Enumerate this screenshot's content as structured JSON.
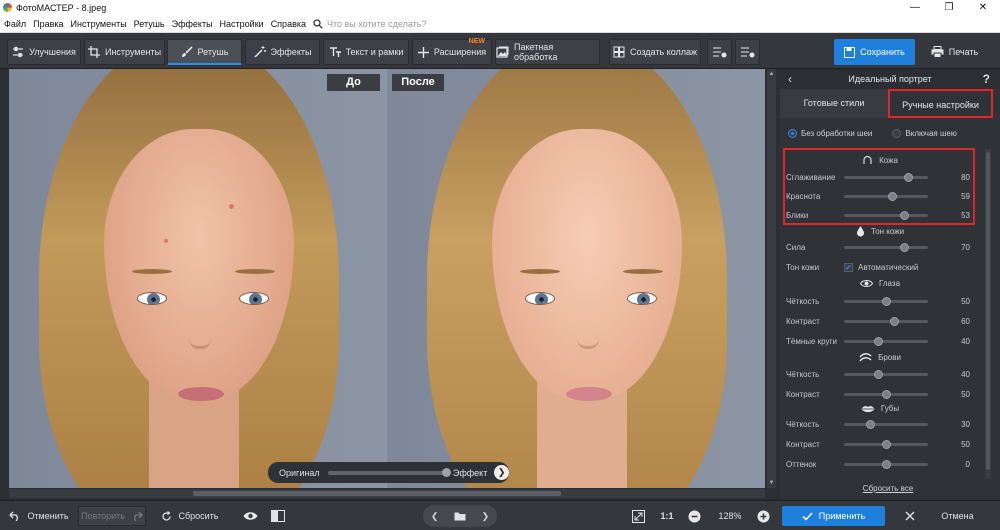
{
  "window": {
    "title": "ФотоМАСТЕР - 8.jpeg",
    "minimize": "—",
    "maximize": "❐",
    "close": "✕"
  },
  "menu": {
    "items": [
      "Файл",
      "Правка",
      "Инструменты",
      "Ретушь",
      "Эффекты",
      "Настройки",
      "Справка"
    ],
    "search_placeholder": "Что вы хотите сделать?"
  },
  "toolbar": {
    "enhance": "Улучшения",
    "tools": "Инструменты",
    "retouch": "Ретушь",
    "effects": "Эффекты",
    "text": "Текст и рамки",
    "extensions": "Расширения",
    "new_badge": "NEW",
    "batch": "Пакетная обработка",
    "collage": "Создать коллаж",
    "save": "Сохранить",
    "print": "Печать"
  },
  "canvas": {
    "before_label": "До",
    "after_label": "После",
    "slider": {
      "left_label": "Оригинал",
      "right_label": "Эффект",
      "value": 1.0
    }
  },
  "panel": {
    "title": "Идеальный портрет",
    "help": "?",
    "tabs": {
      "ready": "Готовые стили",
      "manual": "Ручные настройки"
    },
    "neck": {
      "option_off": "Без обработки шеи",
      "option_on": "Включая шею",
      "selected": "Без обработки шеи"
    },
    "sections": {
      "skin": {
        "title": "Кожа",
        "sliders": [
          {
            "label": "Сглаживание",
            "value": "80"
          },
          {
            "label": "Краснота",
            "value": "59"
          },
          {
            "label": "Блики",
            "value": "53"
          }
        ]
      },
      "skin_tone": {
        "title": "Тон кожи",
        "strength": {
          "label": "Сила",
          "value": "70"
        },
        "tone_label": "Тон кожи",
        "auto_label": "Автоматический",
        "auto_checked": true
      },
      "eyes": {
        "title": "Глаза",
        "sliders": [
          {
            "label": "Чёткость",
            "value": "50"
          },
          {
            "label": "Контраст",
            "value": "60"
          },
          {
            "label": "Тёмные круги",
            "value": "40"
          }
        ]
      },
      "brows": {
        "title": "Брови",
        "sliders": [
          {
            "label": "Чёткость",
            "value": "40"
          },
          {
            "label": "Контраст",
            "value": "50"
          }
        ]
      },
      "lips": {
        "title": "Губы",
        "sliders": [
          {
            "label": "Чёткость",
            "value": "30"
          },
          {
            "label": "Контраст",
            "value": "50"
          },
          {
            "label": "Оттенок",
            "value": "0"
          }
        ]
      }
    },
    "reset_all": "Сбросить все"
  },
  "bottom": {
    "undo": "Отменить",
    "redo": "Повторить",
    "reset": "Сбросить",
    "ratio": "1:1",
    "zoom": "128%",
    "apply": "Применить",
    "cancel": "Отмена"
  },
  "colors": {
    "accent": "#1f7fdc",
    "highlight": "#e0262a",
    "background": "#2b2e33"
  }
}
